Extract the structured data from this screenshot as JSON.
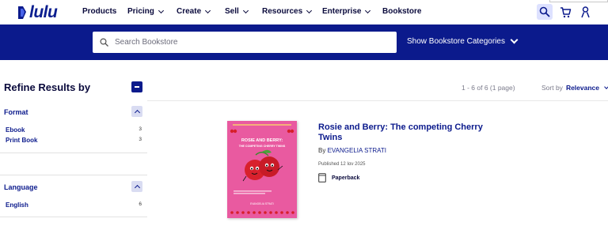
{
  "brand": {
    "logo_text": "lulu",
    "color": "#0b1a8c"
  },
  "nav": [
    {
      "label": "Products",
      "dropdown": false
    },
    {
      "label": "Pricing",
      "dropdown": true
    },
    {
      "label": "Create",
      "dropdown": true
    },
    {
      "label": "Sell",
      "dropdown": true
    },
    {
      "label": "Resources",
      "dropdown": true
    },
    {
      "label": "Enterprise",
      "dropdown": true
    },
    {
      "label": "Bookstore",
      "dropdown": false
    }
  ],
  "header_icons": [
    "search-icon",
    "cart-icon",
    "user-icon"
  ],
  "search": {
    "placeholder": "Search Bookstore",
    "value": ""
  },
  "categories_toggle": "Show Bookstore Categories",
  "sidebar": {
    "title": "Refine Results by",
    "facets": [
      {
        "title": "Format",
        "items": [
          {
            "label": "Ebook",
            "count": "3"
          },
          {
            "label": "Print Book",
            "count": "3"
          }
        ]
      },
      {
        "title": "Language",
        "items": [
          {
            "label": "English",
            "count": "6"
          }
        ]
      }
    ]
  },
  "results": {
    "count_text": "1 - 6 of 6 (1 page)",
    "sort_label": "Sort by",
    "sort_value": "Relevance"
  },
  "book": {
    "title": "Rosie and Berry: The competing Cherry Twins",
    "author_prefix": "By",
    "author": "EVANGELIA STRATI",
    "published": "Published 12 Ιαν 2025",
    "format": "Paperback",
    "cover": {
      "heading": "ROSIE AND BERRY:",
      "subheading": "THE COMPETING CHERRY TWINS",
      "author": "EVANGELIA STRATI",
      "background": "#e95aa0"
    }
  }
}
